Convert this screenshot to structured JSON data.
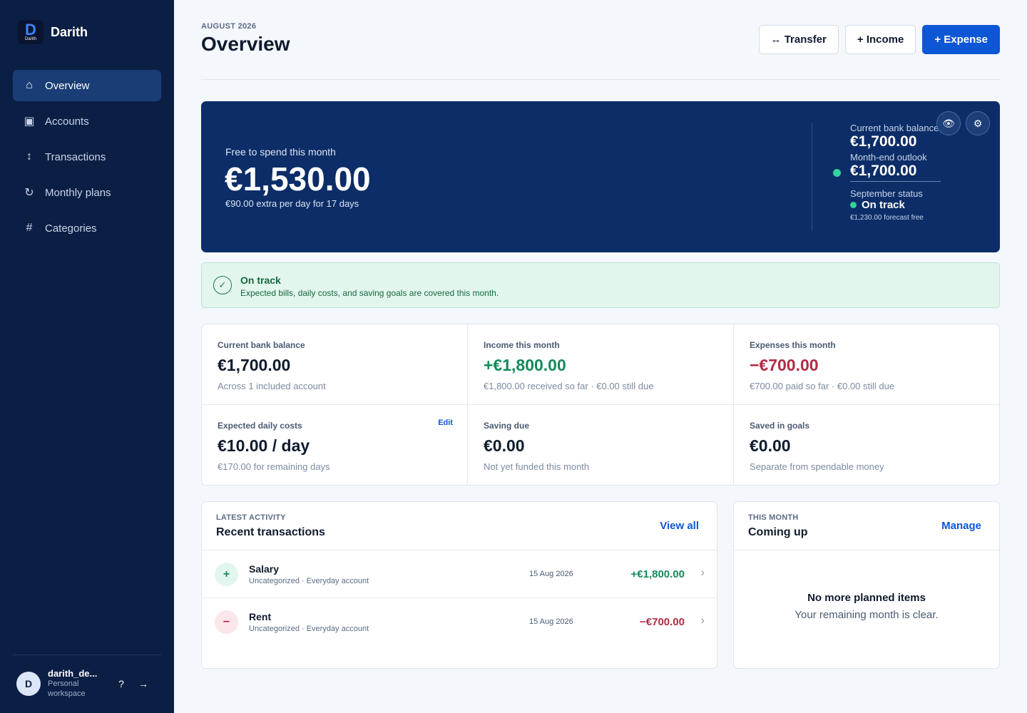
{
  "app": {
    "name": "Darith",
    "logo_letter": "D",
    "logo_word": "Darith"
  },
  "sidebar": {
    "items": [
      {
        "label": "Overview",
        "icon": "home-icon",
        "glyph": "⌂",
        "active": true
      },
      {
        "label": "Accounts",
        "icon": "account-card-icon",
        "glyph": "▣",
        "active": false
      },
      {
        "label": "Transactions",
        "icon": "transfer-arrows-icon",
        "glyph": "↕",
        "active": false
      },
      {
        "label": "Monthly plans",
        "icon": "refresh-icon",
        "glyph": "↻",
        "active": false
      },
      {
        "label": "Categories",
        "icon": "hash-icon",
        "glyph": "#",
        "active": false
      }
    ],
    "user": {
      "initial": "D",
      "name": "darith_de...",
      "workspace": "Personal workspace",
      "help_glyph": "?",
      "logout_glyph": "→"
    }
  },
  "header": {
    "eyebrow": "AUGUST 2026",
    "title": "Overview",
    "actions": {
      "transfer": "↔ Transfer",
      "income": "+ Income",
      "expense": "+ Expense"
    }
  },
  "hero": {
    "label": "Free to spend this month",
    "amount": "€1,530.00",
    "sub": "€90.00 extra per day for 17 days",
    "bank_label": "Current bank balance",
    "bank_amount": "€1,700.00",
    "outlook_label": "Month-end outlook",
    "outlook_amount": "€1,700.00",
    "next_label": "September status",
    "next_status": "On track",
    "next_note": "€1,230.00 forecast free",
    "eye_glyph": "👁",
    "gear_glyph": "⚙"
  },
  "banner": {
    "title": "On track",
    "text": "Expected bills, daily costs, and saving goals are covered this month.",
    "glyph": "✓"
  },
  "stats": [
    {
      "label": "Current bank balance",
      "value": "€1,700.00",
      "sub": "Across 1 included account",
      "tone": ""
    },
    {
      "label": "Income this month",
      "value": "+€1,800.00",
      "sub": "€1,800.00 received so far · €0.00 still due",
      "tone": "pos"
    },
    {
      "label": "Expenses this month",
      "value": "−€700.00",
      "sub": "€700.00 paid so far · €0.00 still due",
      "tone": "neg"
    },
    {
      "label": "Expected daily costs",
      "value": "€10.00 / day",
      "sub": "€170.00 for remaining days",
      "tone": "",
      "edit": "Edit"
    },
    {
      "label": "Saving due",
      "value": "€0.00",
      "sub": "Not yet funded this month",
      "tone": ""
    },
    {
      "label": "Saved in goals",
      "value": "€0.00",
      "sub": "Separate from spendable money",
      "tone": ""
    }
  ],
  "recent": {
    "eyebrow": "LATEST ACTIVITY",
    "title": "Recent transactions",
    "link": "View all",
    "rows": [
      {
        "glyph": "+",
        "tone": "pos",
        "name": "Salary",
        "meta": "Uncategorized · Everyday account",
        "date": "15 Aug 2026",
        "amount": "+€1,800.00",
        "chevron": "›"
      },
      {
        "glyph": "−",
        "tone": "neg",
        "name": "Rent",
        "meta": "Uncategorized · Everyday account",
        "date": "15 Aug 2026",
        "amount": "−€700.00",
        "chevron": "›"
      }
    ]
  },
  "upcoming": {
    "eyebrow": "THIS MONTH",
    "title": "Coming up",
    "link": "Manage",
    "empty_title": "No more planned items",
    "empty_text": "Your remaining month is clear."
  },
  "colors": {
    "sidebar_bg": "#0b1f45",
    "hero_bg": "#0c2d67",
    "accent": "#0d57d6",
    "positive": "#148a5a",
    "negative": "#b02c45",
    "success_bg": "#e3f6ee"
  }
}
